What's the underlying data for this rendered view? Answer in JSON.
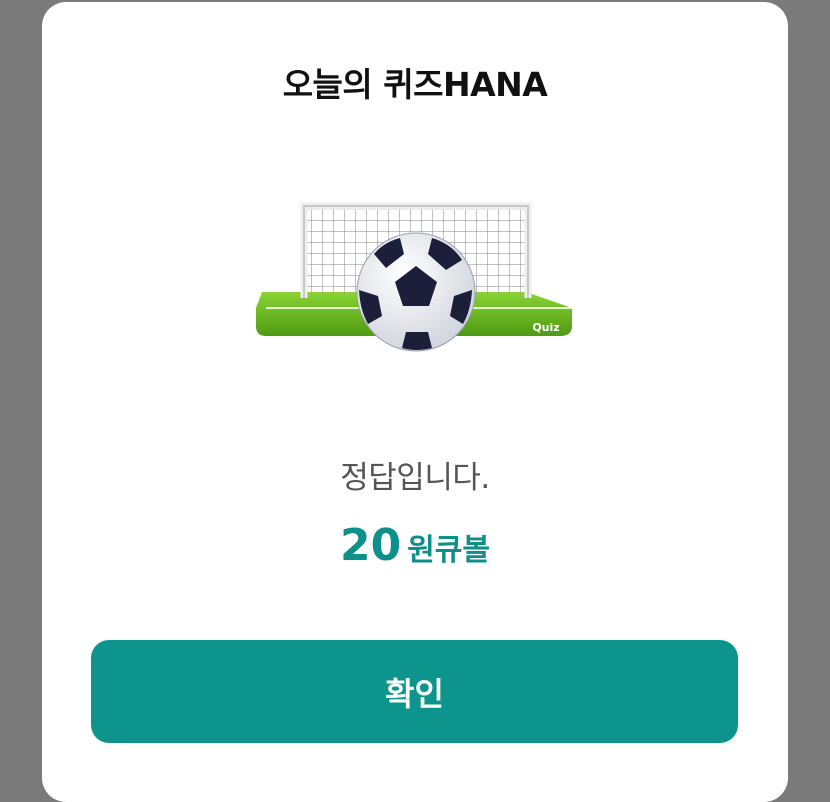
{
  "dialog": {
    "title": "오늘의 퀴즈HANA",
    "illustration": {
      "icon": "soccer-goal-icon",
      "badge_text": "Quiz"
    },
    "message": "정답입니다.",
    "reward": {
      "amount": "20",
      "unit": "원큐볼"
    },
    "confirm_label": "확인"
  },
  "colors": {
    "accent": "#0d948c",
    "overlay": "#7a7a7a",
    "grass": "#6cc21e"
  }
}
